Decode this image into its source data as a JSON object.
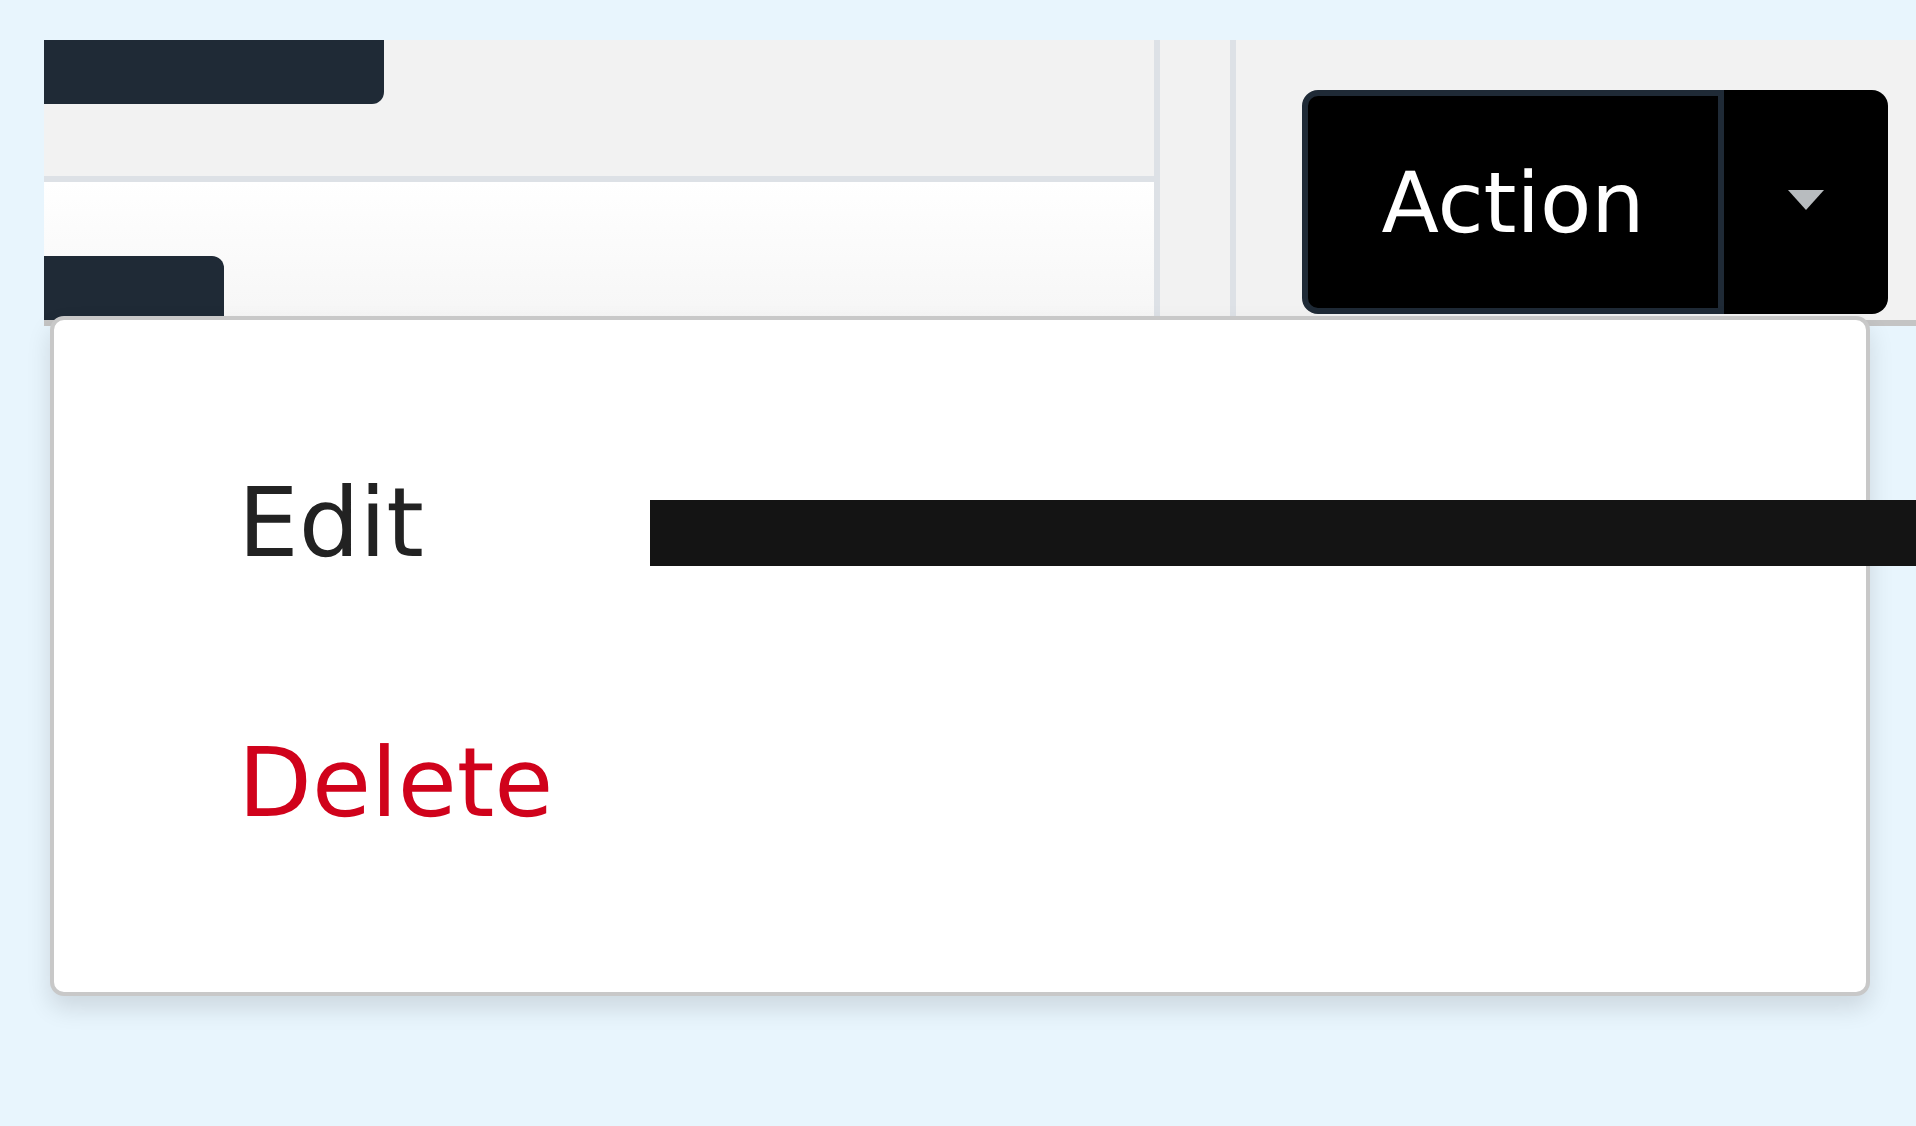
{
  "action_button": {
    "label": "Action"
  },
  "menu": {
    "items": [
      {
        "label": "Edit",
        "kind": "normal"
      },
      {
        "label": "Delete",
        "kind": "danger"
      }
    ]
  }
}
